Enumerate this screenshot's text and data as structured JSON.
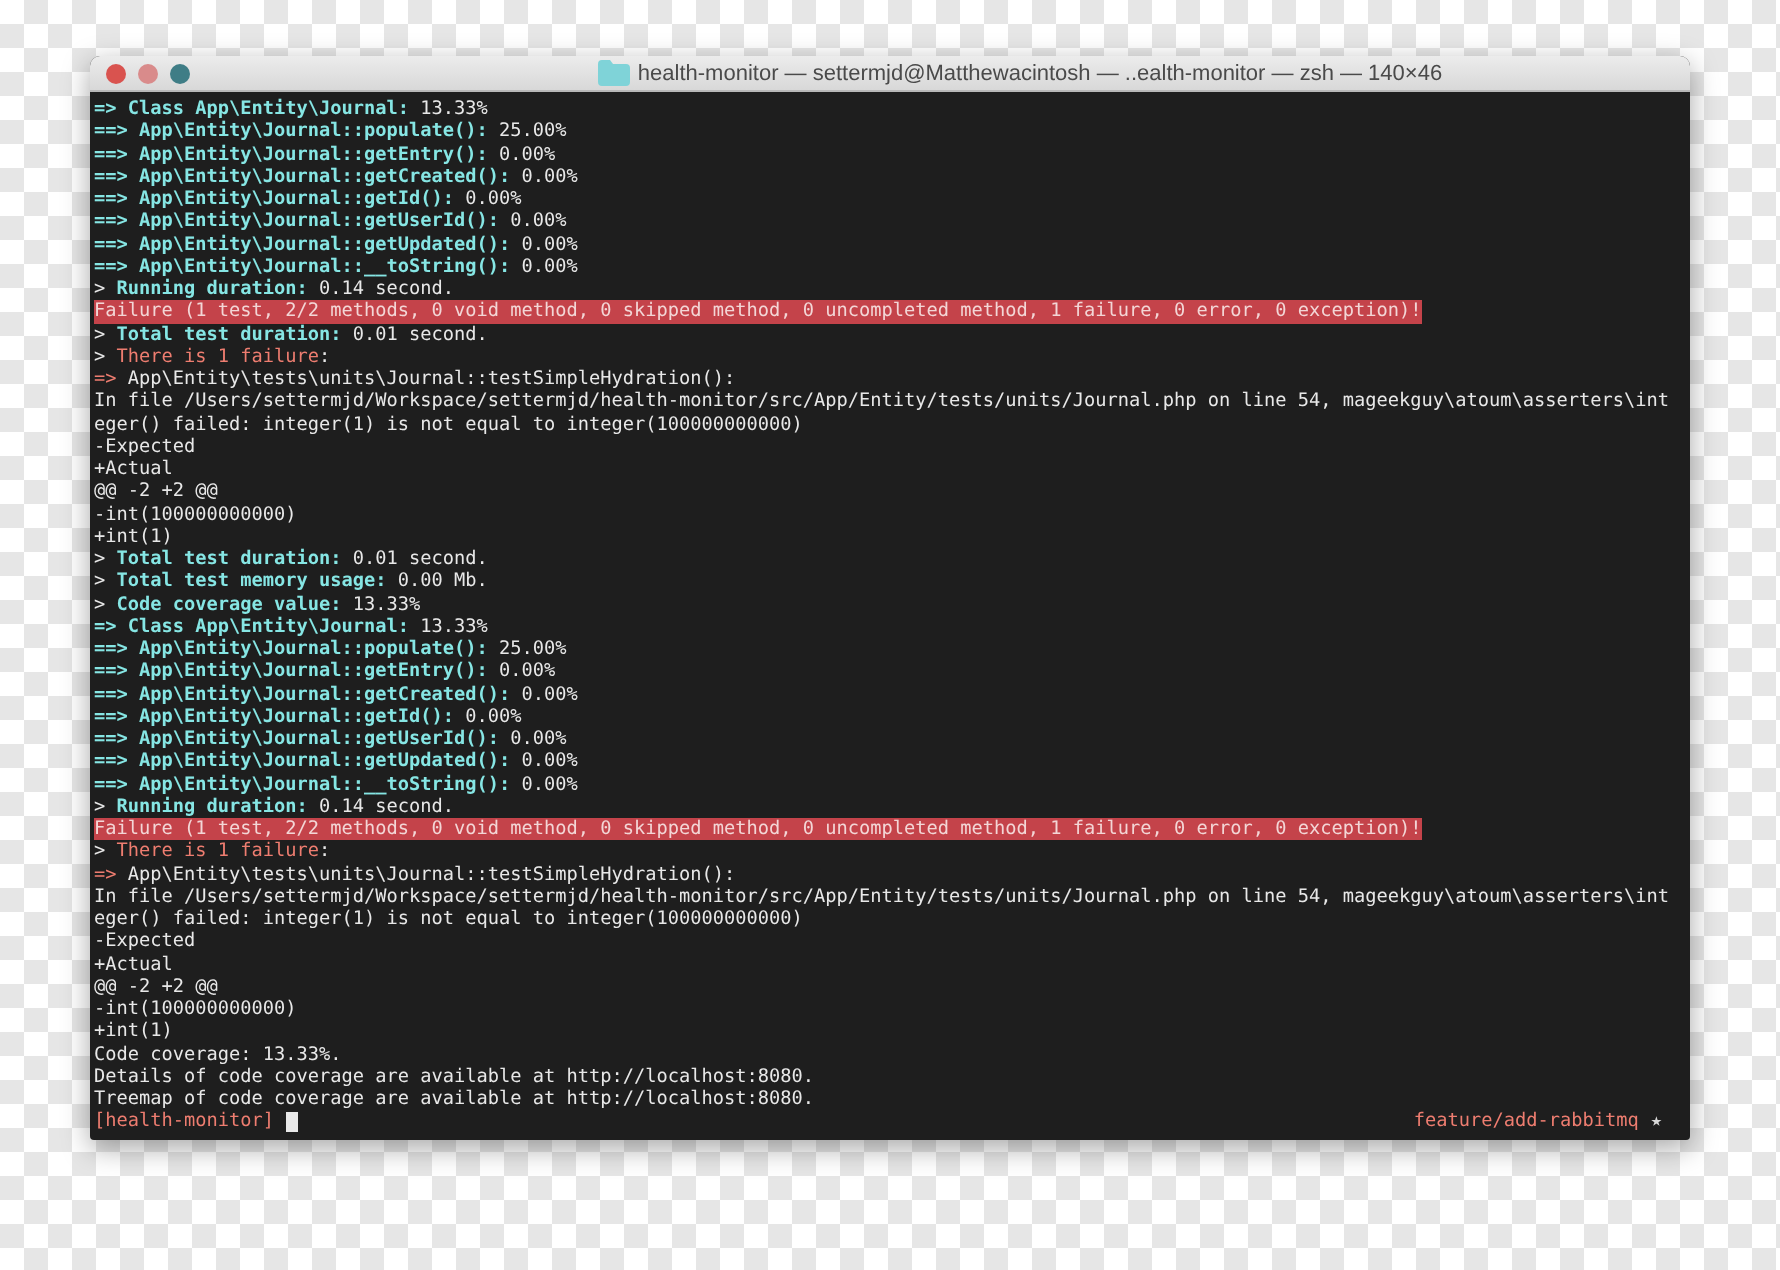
{
  "window": {
    "title": "health-monitor — settermjd@Matthewacintosh — ..ealth-monitor — zsh — 140×46"
  },
  "lines": [
    {
      "highlight": false,
      "segments": [
        {
          "kind": "accent",
          "text": "=> Class App\\Entity\\Journal:"
        },
        {
          "kind": "plain",
          "text": " 13.33%"
        }
      ]
    },
    {
      "highlight": false,
      "segments": [
        {
          "kind": "accent",
          "text": "==> App\\Entity\\Journal::populate():"
        },
        {
          "kind": "plain",
          "text": " 25.00%"
        }
      ]
    },
    {
      "highlight": false,
      "segments": [
        {
          "kind": "accent",
          "text": "==> App\\Entity\\Journal::getEntry():"
        },
        {
          "kind": "plain",
          "text": " 0.00%"
        }
      ]
    },
    {
      "highlight": false,
      "segments": [
        {
          "kind": "accent",
          "text": "==> App\\Entity\\Journal::getCreated():"
        },
        {
          "kind": "plain",
          "text": " 0.00%"
        }
      ]
    },
    {
      "highlight": false,
      "segments": [
        {
          "kind": "accent",
          "text": "==> App\\Entity\\Journal::getId():"
        },
        {
          "kind": "plain",
          "text": " 0.00%"
        }
      ]
    },
    {
      "highlight": false,
      "segments": [
        {
          "kind": "accent",
          "text": "==> App\\Entity\\Journal::getUserId():"
        },
        {
          "kind": "plain",
          "text": " 0.00%"
        }
      ]
    },
    {
      "highlight": false,
      "segments": [
        {
          "kind": "accent",
          "text": "==> App\\Entity\\Journal::getUpdated():"
        },
        {
          "kind": "plain",
          "text": " 0.00%"
        }
      ]
    },
    {
      "highlight": false,
      "segments": [
        {
          "kind": "accent",
          "text": "==> App\\Entity\\Journal::__toString():"
        },
        {
          "kind": "plain",
          "text": " 0.00%"
        }
      ]
    },
    {
      "highlight": false,
      "segments": [
        {
          "kind": "plain",
          "text": "> "
        },
        {
          "kind": "accent",
          "text": "Running duration:"
        },
        {
          "kind": "plain",
          "text": " 0.14 second."
        }
      ]
    },
    {
      "highlight": true,
      "segments": [
        {
          "kind": "plain",
          "text": "Failure (1 test, 2/2 methods, 0 void method, 0 skipped method, 0 uncompleted method, 1 failure, 0 error, 0 exception)!"
        }
      ]
    },
    {
      "highlight": false,
      "segments": [
        {
          "kind": "plain",
          "text": "> "
        },
        {
          "kind": "accent",
          "text": "Total test duration:"
        },
        {
          "kind": "plain",
          "text": " 0.01 second."
        }
      ]
    },
    {
      "highlight": false,
      "segments": [
        {
          "kind": "plain",
          "text": "> "
        },
        {
          "kind": "alert",
          "text": "There is 1 failure"
        },
        {
          "kind": "plain",
          "text": ":"
        }
      ]
    },
    {
      "highlight": false,
      "segments": [
        {
          "kind": "alert",
          "text": "=>"
        },
        {
          "kind": "plain",
          "text": " App\\Entity\\tests\\units\\Journal::testSimpleHydration():"
        }
      ]
    },
    {
      "highlight": false,
      "segments": [
        {
          "kind": "plain",
          "text": "In file /Users/settermjd/Workspace/settermjd/health-monitor/src/App/Entity/tests/units/Journal.php on line 54, mageekguy\\atoum\\asserters\\int"
        }
      ]
    },
    {
      "highlight": false,
      "segments": [
        {
          "kind": "plain",
          "text": "eger() failed: integer(1) is not equal to integer(100000000000)"
        }
      ]
    },
    {
      "highlight": false,
      "segments": [
        {
          "kind": "plain",
          "text": "-Expected"
        }
      ]
    },
    {
      "highlight": false,
      "segments": [
        {
          "kind": "plain",
          "text": "+Actual"
        }
      ]
    },
    {
      "highlight": false,
      "segments": [
        {
          "kind": "plain",
          "text": "@@ -2 +2 @@"
        }
      ]
    },
    {
      "highlight": false,
      "segments": [
        {
          "kind": "plain",
          "text": "-int(100000000000)"
        }
      ]
    },
    {
      "highlight": false,
      "segments": [
        {
          "kind": "plain",
          "text": "+int(1)"
        }
      ]
    },
    {
      "highlight": false,
      "segments": [
        {
          "kind": "plain",
          "text": "> "
        },
        {
          "kind": "accent",
          "text": "Total test duration:"
        },
        {
          "kind": "plain",
          "text": " 0.01 second."
        }
      ]
    },
    {
      "highlight": false,
      "segments": [
        {
          "kind": "plain",
          "text": "> "
        },
        {
          "kind": "accent",
          "text": "Total test memory usage:"
        },
        {
          "kind": "plain",
          "text": " 0.00 Mb."
        }
      ]
    },
    {
      "highlight": false,
      "segments": [
        {
          "kind": "plain",
          "text": "> "
        },
        {
          "kind": "accent",
          "text": "Code coverage value:"
        },
        {
          "kind": "plain",
          "text": " 13.33%"
        }
      ]
    },
    {
      "highlight": false,
      "segments": [
        {
          "kind": "accent",
          "text": "=> Class App\\Entity\\Journal:"
        },
        {
          "kind": "plain",
          "text": " 13.33%"
        }
      ]
    },
    {
      "highlight": false,
      "segments": [
        {
          "kind": "accent",
          "text": "==> App\\Entity\\Journal::populate():"
        },
        {
          "kind": "plain",
          "text": " 25.00%"
        }
      ]
    },
    {
      "highlight": false,
      "segments": [
        {
          "kind": "accent",
          "text": "==> App\\Entity\\Journal::getEntry():"
        },
        {
          "kind": "plain",
          "text": " 0.00%"
        }
      ]
    },
    {
      "highlight": false,
      "segments": [
        {
          "kind": "accent",
          "text": "==> App\\Entity\\Journal::getCreated():"
        },
        {
          "kind": "plain",
          "text": " 0.00%"
        }
      ]
    },
    {
      "highlight": false,
      "segments": [
        {
          "kind": "accent",
          "text": "==> App\\Entity\\Journal::getId():"
        },
        {
          "kind": "plain",
          "text": " 0.00%"
        }
      ]
    },
    {
      "highlight": false,
      "segments": [
        {
          "kind": "accent",
          "text": "==> App\\Entity\\Journal::getUserId():"
        },
        {
          "kind": "plain",
          "text": " 0.00%"
        }
      ]
    },
    {
      "highlight": false,
      "segments": [
        {
          "kind": "accent",
          "text": "==> App\\Entity\\Journal::getUpdated():"
        },
        {
          "kind": "plain",
          "text": " 0.00%"
        }
      ]
    },
    {
      "highlight": false,
      "segments": [
        {
          "kind": "accent",
          "text": "==> App\\Entity\\Journal::__toString():"
        },
        {
          "kind": "plain",
          "text": " 0.00%"
        }
      ]
    },
    {
      "highlight": false,
      "segments": [
        {
          "kind": "plain",
          "text": "> "
        },
        {
          "kind": "accent",
          "text": "Running duration:"
        },
        {
          "kind": "plain",
          "text": " 0.14 second."
        }
      ]
    },
    {
      "highlight": true,
      "segments": [
        {
          "kind": "plain",
          "text": "Failure (1 test, 2/2 methods, 0 void method, 0 skipped method, 0 uncompleted method, 1 failure, 0 error, 0 exception)!"
        }
      ]
    },
    {
      "highlight": false,
      "segments": [
        {
          "kind": "plain",
          "text": "> "
        },
        {
          "kind": "alert",
          "text": "There is 1 failure"
        },
        {
          "kind": "plain",
          "text": ":"
        }
      ]
    },
    {
      "highlight": false,
      "segments": [
        {
          "kind": "alert",
          "text": "=>"
        },
        {
          "kind": "plain",
          "text": " App\\Entity\\tests\\units\\Journal::testSimpleHydration():"
        }
      ]
    },
    {
      "highlight": false,
      "segments": [
        {
          "kind": "plain",
          "text": "In file /Users/settermjd/Workspace/settermjd/health-monitor/src/App/Entity/tests/units/Journal.php on line 54, mageekguy\\atoum\\asserters\\int"
        }
      ]
    },
    {
      "highlight": false,
      "segments": [
        {
          "kind": "plain",
          "text": "eger() failed: integer(1) is not equal to integer(100000000000)"
        }
      ]
    },
    {
      "highlight": false,
      "segments": [
        {
          "kind": "plain",
          "text": "-Expected"
        }
      ]
    },
    {
      "highlight": false,
      "segments": [
        {
          "kind": "plain",
          "text": "+Actual"
        }
      ]
    },
    {
      "highlight": false,
      "segments": [
        {
          "kind": "plain",
          "text": "@@ -2 +2 @@"
        }
      ]
    },
    {
      "highlight": false,
      "segments": [
        {
          "kind": "plain",
          "text": "-int(100000000000)"
        }
      ]
    },
    {
      "highlight": false,
      "segments": [
        {
          "kind": "plain",
          "text": "+int(1)"
        }
      ]
    },
    {
      "highlight": false,
      "segments": [
        {
          "kind": "plain",
          "text": "Code coverage: 13.33%."
        }
      ]
    },
    {
      "highlight": false,
      "segments": [
        {
          "kind": "plain",
          "text": "Details of code coverage are available at http://localhost:8080."
        }
      ]
    },
    {
      "highlight": false,
      "segments": [
        {
          "kind": "plain",
          "text": "Treemap of code coverage are available at http://localhost:8080."
        }
      ]
    }
  ],
  "prompt": {
    "text": "[health-monitor]",
    "branch": "feature/add-rabbitmq",
    "marker": "★"
  }
}
